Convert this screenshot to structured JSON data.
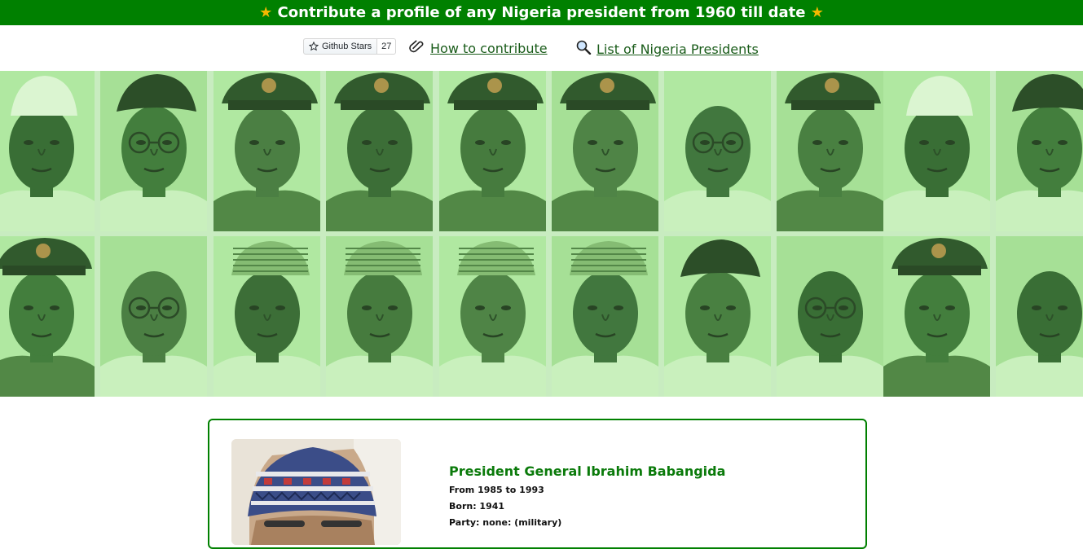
{
  "banner": {
    "title": "Contribute a profile of any Nigeria president from 1960 till date",
    "star_icon": "star-icon"
  },
  "toolbar": {
    "github_label": "Github Stars",
    "github_count": "27",
    "how_to_label": "How to contribute",
    "list_label": "List of Nigeria Presidents"
  },
  "mosaic": {
    "portraits_row1": [
      "hat-white",
      "hat-black",
      "cap-officer",
      "cap-officer",
      "cap-officer",
      "cap-officer",
      "bare-glasses",
      "cap-officer",
      "hat-white",
      "hat-black"
    ],
    "portraits_row2": [
      "cap-officer",
      "bare",
      "cap-cloth",
      "cap-cloth",
      "cap-cloth",
      "cap-cloth",
      "hat-black",
      "bare-glasses",
      "cap-officer",
      "bare"
    ]
  },
  "profile": {
    "name": "President General Ibrahim Babangida",
    "term": "From 1985 to 1993",
    "born": "Born: 1941",
    "party": "Party: none: (military)"
  },
  "colors": {
    "brand_green": "#008000",
    "tint": "#b8f0a8"
  }
}
